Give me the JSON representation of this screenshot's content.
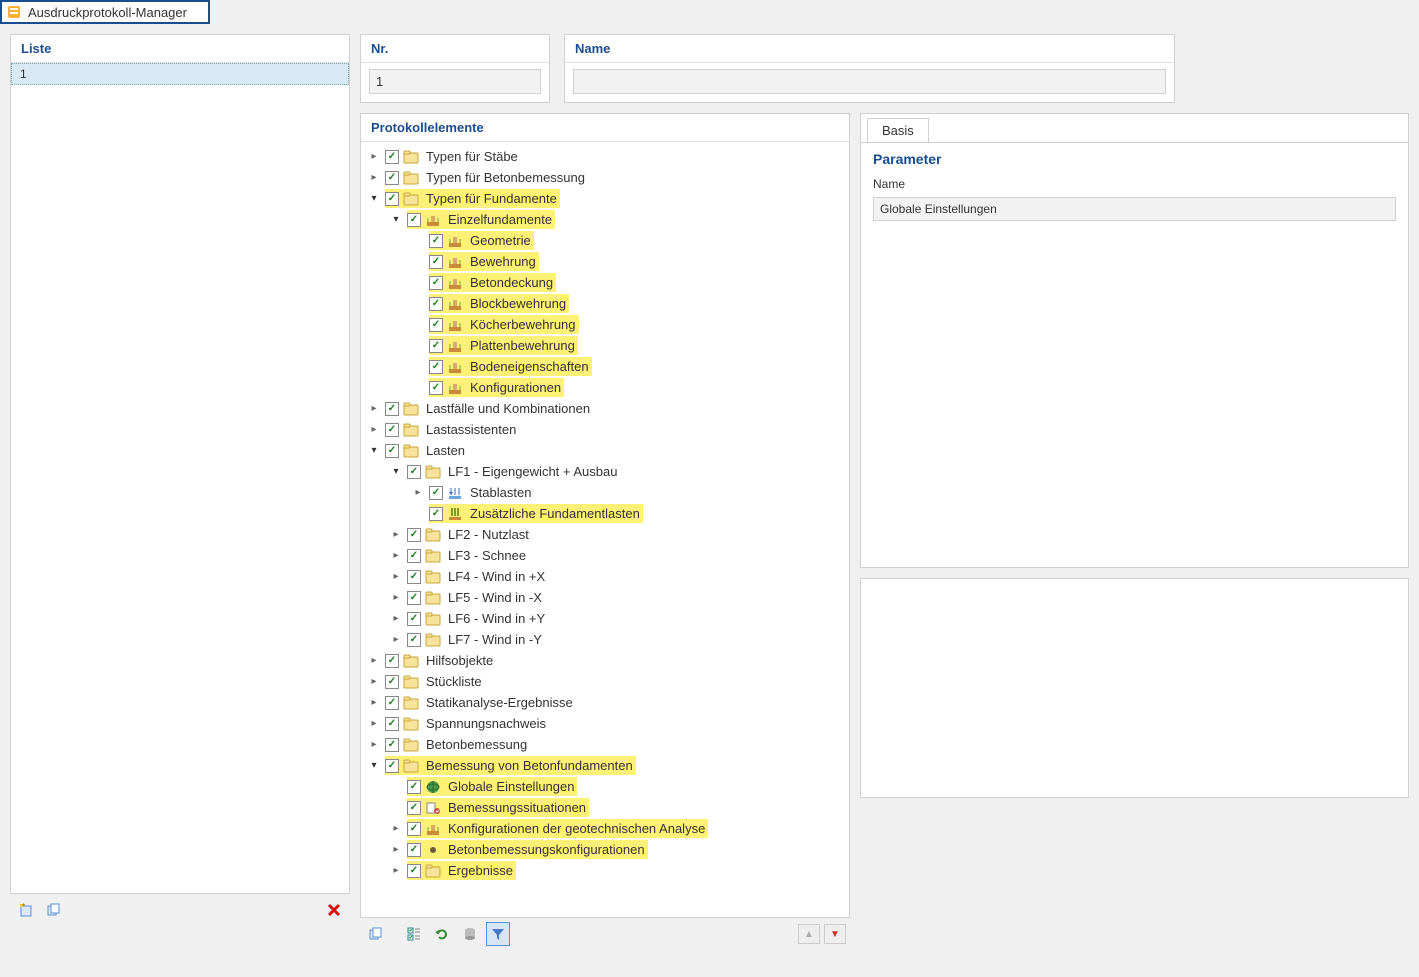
{
  "window": {
    "title": "Ausdruckprotokoll-Manager"
  },
  "liste": {
    "header": "Liste",
    "rows": [
      "1"
    ]
  },
  "top": {
    "nr_label": "Nr.",
    "nr_value": "1",
    "name_label": "Name",
    "name_value": ""
  },
  "protokoll_header": "Protokollelemente",
  "tree": [
    {
      "d": 0,
      "arrow": ">",
      "chk": true,
      "icon": "folder",
      "label": "Typen für Stäbe",
      "hl": false
    },
    {
      "d": 0,
      "arrow": ">",
      "chk": true,
      "icon": "folder",
      "label": "Typen für Betonbemessung",
      "hl": false
    },
    {
      "d": 0,
      "arrow": "v",
      "chk": true,
      "icon": "folder",
      "label": "Typen für Fundamente",
      "hl": true
    },
    {
      "d": 1,
      "arrow": "v",
      "chk": true,
      "icon": "fund",
      "label": "Einzelfundamente",
      "hl": true
    },
    {
      "d": 2,
      "arrow": "",
      "chk": true,
      "icon": "fund",
      "label": "Geometrie",
      "hl": true
    },
    {
      "d": 2,
      "arrow": "",
      "chk": true,
      "icon": "fund",
      "label": "Bewehrung",
      "hl": true
    },
    {
      "d": 2,
      "arrow": "",
      "chk": true,
      "icon": "fund",
      "label": "Betondeckung",
      "hl": true
    },
    {
      "d": 2,
      "arrow": "",
      "chk": true,
      "icon": "fund",
      "label": "Blockbewehrung",
      "hl": true
    },
    {
      "d": 2,
      "arrow": "",
      "chk": true,
      "icon": "fund",
      "label": "Köcherbewehrung",
      "hl": true
    },
    {
      "d": 2,
      "arrow": "",
      "chk": true,
      "icon": "fund",
      "label": "Plattenbewehrung",
      "hl": true
    },
    {
      "d": 2,
      "arrow": "",
      "chk": true,
      "icon": "fund",
      "label": "Bodeneigenschaften",
      "hl": true
    },
    {
      "d": 2,
      "arrow": "",
      "chk": true,
      "icon": "fund",
      "label": "Konfigurationen",
      "hl": true
    },
    {
      "d": 0,
      "arrow": ">",
      "chk": true,
      "icon": "folder",
      "label": "Lastfälle und Kombinationen",
      "hl": false
    },
    {
      "d": 0,
      "arrow": ">",
      "chk": true,
      "icon": "folder",
      "label": "Lastassistenten",
      "hl": false
    },
    {
      "d": 0,
      "arrow": "v",
      "chk": true,
      "icon": "folder",
      "label": "Lasten",
      "hl": false
    },
    {
      "d": 1,
      "arrow": "v",
      "chk": true,
      "icon": "folder",
      "label": "LF1 - Eigengewicht + Ausbau",
      "hl": false
    },
    {
      "d": 2,
      "arrow": ">",
      "chk": true,
      "icon": "load",
      "label": "Stablasten",
      "hl": false
    },
    {
      "d": 2,
      "arrow": "",
      "chk": true,
      "icon": "fload",
      "label": "Zusätzliche Fundamentlasten",
      "hl": true
    },
    {
      "d": 1,
      "arrow": ">",
      "chk": true,
      "icon": "folder",
      "label": "LF2 - Nutzlast",
      "hl": false
    },
    {
      "d": 1,
      "arrow": ">",
      "chk": true,
      "icon": "folder",
      "label": "LF3 - Schnee",
      "hl": false
    },
    {
      "d": 1,
      "arrow": ">",
      "chk": true,
      "icon": "folder",
      "label": "LF4 - Wind in +X",
      "hl": false
    },
    {
      "d": 1,
      "arrow": ">",
      "chk": true,
      "icon": "folder",
      "label": "LF5 - Wind in -X",
      "hl": false
    },
    {
      "d": 1,
      "arrow": ">",
      "chk": true,
      "icon": "folder",
      "label": "LF6 - Wind in +Y",
      "hl": false
    },
    {
      "d": 1,
      "arrow": ">",
      "chk": true,
      "icon": "folder",
      "label": "LF7 - Wind in -Y",
      "hl": false
    },
    {
      "d": 0,
      "arrow": ">",
      "chk": true,
      "icon": "folder",
      "label": "Hilfsobjekte",
      "hl": false
    },
    {
      "d": 0,
      "arrow": ">",
      "chk": true,
      "icon": "folder",
      "label": "Stückliste",
      "hl": false
    },
    {
      "d": 0,
      "arrow": ">",
      "chk": true,
      "icon": "folder",
      "label": "Statikanalyse-Ergebnisse",
      "hl": false
    },
    {
      "d": 0,
      "arrow": ">",
      "chk": true,
      "icon": "folder",
      "label": "Spannungsnachweis",
      "hl": false
    },
    {
      "d": 0,
      "arrow": ">",
      "chk": true,
      "icon": "folder",
      "label": "Betonbemessung",
      "hl": false
    },
    {
      "d": 0,
      "arrow": "v",
      "chk": true,
      "icon": "folder",
      "label": "Bemessung von Betonfundamenten",
      "hl": true
    },
    {
      "d": 1,
      "arrow": "",
      "chk": true,
      "icon": "globe",
      "label": "Globale Einstellungen",
      "hl": true
    },
    {
      "d": 1,
      "arrow": "",
      "chk": true,
      "icon": "situ",
      "label": "Bemessungssituationen",
      "hl": true
    },
    {
      "d": 1,
      "arrow": ">",
      "chk": true,
      "icon": "fund",
      "label": "Konfigurationen der geotechnischen Analyse",
      "hl": true
    },
    {
      "d": 1,
      "arrow": ">",
      "chk": true,
      "icon": "dot",
      "label": "Betonbemessungskonfigurationen",
      "hl": true
    },
    {
      "d": 1,
      "arrow": ">",
      "chk": true,
      "icon": "folder",
      "label": "Ergebnisse",
      "hl": true
    }
  ],
  "props": {
    "tab": "Basis",
    "header": "Parameter",
    "name_label": "Name",
    "name_value": "Globale Einstellungen"
  },
  "icons": {
    "folder": "folder-icon",
    "fund": "foundation-icon",
    "load": "barload-icon",
    "fload": "foundation-load-icon",
    "globe": "globe-icon",
    "situ": "situation-icon",
    "dot": "dot-icon"
  }
}
